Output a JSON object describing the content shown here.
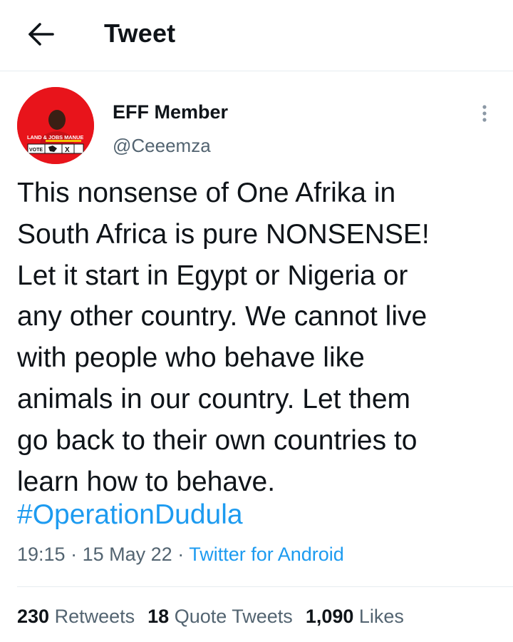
{
  "header": {
    "title": "Tweet",
    "back_icon": "arrow-left-icon"
  },
  "tweet": {
    "avatar": {
      "icon": "profile-photo",
      "banner_text": "LAND & JOBS MANUE",
      "ballot_text": "VOTE",
      "ballot_mark": "X"
    },
    "display_name": "EFF Member",
    "handle": "@Ceeemza",
    "more_icon": "more-vertical-icon",
    "text": "This nonsense of One Afrika in\nSouth Africa is pure NONSENSE!\nLet it start in Egypt or Nigeria or\nany other country. We cannot live\nwith people who behave like\nanimals in our country. Let them\ngo back to their own countries to\nlearn how to behave.",
    "hashtag": "#OperationDudula",
    "time": "19:15",
    "separator": "·",
    "date": "15 May 22",
    "source": "Twitter for Android"
  },
  "stats": {
    "retweets_count": "230",
    "retweets_label": "Retweets",
    "quotes_count": "18",
    "quotes_label": "Quote Tweets",
    "likes_count": "1,090",
    "likes_label": "Likes"
  },
  "colors": {
    "text": "#0f1419",
    "secondary": "#536471",
    "link": "#1d9bf0",
    "border": "#e6ecf0",
    "avatar_bg": "#e8141b"
  }
}
